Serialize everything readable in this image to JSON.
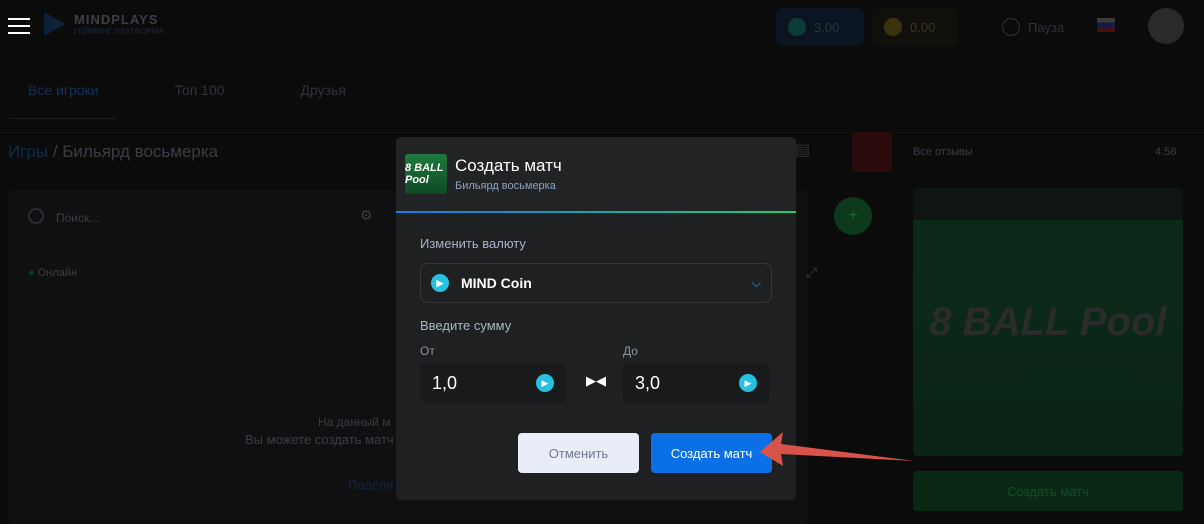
{
  "header": {
    "logo": "MINDPLAYS",
    "logo_sub": "ГЕЙМИНГ ПЛАТФОРМА",
    "balance_mind": "3.00",
    "balance_gold": "0.00",
    "pause": "Пауза"
  },
  "tabs": [
    "Все игроки",
    "Топ 100",
    "Друзья"
  ],
  "breadcrumb": {
    "root": "Игры",
    "sep": " / ",
    "current": "Бильярд восьмерка"
  },
  "left": {
    "search_placeholder": "Поиск...",
    "online": "Онлайн",
    "empty1": "На данный м",
    "empty2": "Вы можете создать матч",
    "share": "Подели"
  },
  "right": {
    "reviews": "Все отзывы",
    "rating": "4.58",
    "create": "Создать матч",
    "game_logo": "8 BALL Pool"
  },
  "modal": {
    "title": "Создать матч",
    "subtitle": "Бильярд восьмерка",
    "thumb": "8 BALL Pool",
    "currency_label": "Изменить валюту",
    "currency": "MIND Coin",
    "sum_label": "Введите сумму",
    "from_label": "От",
    "from": "1,0",
    "to_label": "До",
    "to": "3,0",
    "cancel": "Отменить",
    "create": "Создать матч"
  },
  "colors": {
    "accent": "#0b6fe6",
    "arrow": "#d9534a"
  }
}
